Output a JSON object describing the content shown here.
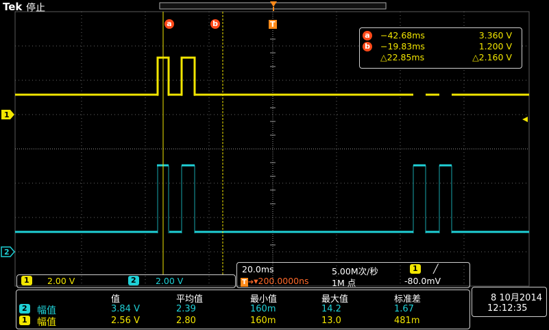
{
  "header": {
    "brand": "Tek",
    "run_state": "停止"
  },
  "cursors": {
    "a_label": "a",
    "b_label": "b",
    "trigger_label": "T",
    "readout": {
      "a_time": "−42.68ms",
      "a_volt": "3.360 V",
      "b_time": "−19.83ms",
      "b_volt": "1.200 V",
      "delta_time": "△22.85ms",
      "delta_volt": "△2.160 V"
    }
  },
  "channels": {
    "ch1": {
      "label": "1",
      "scale": "2.00 V",
      "color": "#f2e600"
    },
    "ch2": {
      "label": "2",
      "scale": "2.00 V",
      "color": "#1fd0d6"
    }
  },
  "timebase": {
    "time_per_div": "20.0ms",
    "sample_rate": "5.00M次/秒",
    "trigger_source": "1",
    "trigger_slope_icon": "rising-edge-icon",
    "trigger_slope_symbol": "╱",
    "trigger_position": "▾200.0000ns",
    "record_length": "1M 点",
    "trigger_level": "-80.0mV"
  },
  "measurements": {
    "headers": [
      "值",
      "平均值",
      "最小值",
      "最大值",
      "标准差"
    ],
    "rows": [
      {
        "channel": "2",
        "name": "幅值",
        "value": "3.84 V",
        "mean": "2.39",
        "min": "160m",
        "max": "14.2",
        "std": "1.67"
      },
      {
        "channel": "1",
        "name": "幅值",
        "value": "2.56 V",
        "mean": "2.80",
        "min": "160m",
        "max": "13.0",
        "std": "481m"
      }
    ]
  },
  "datetime": {
    "date": "8 10月2014",
    "time": "12:12:35"
  },
  "colors": {
    "cursor_a": "#ff4a1a",
    "trigger": "#ff8a1a",
    "grid": "#8a8a8a"
  }
}
